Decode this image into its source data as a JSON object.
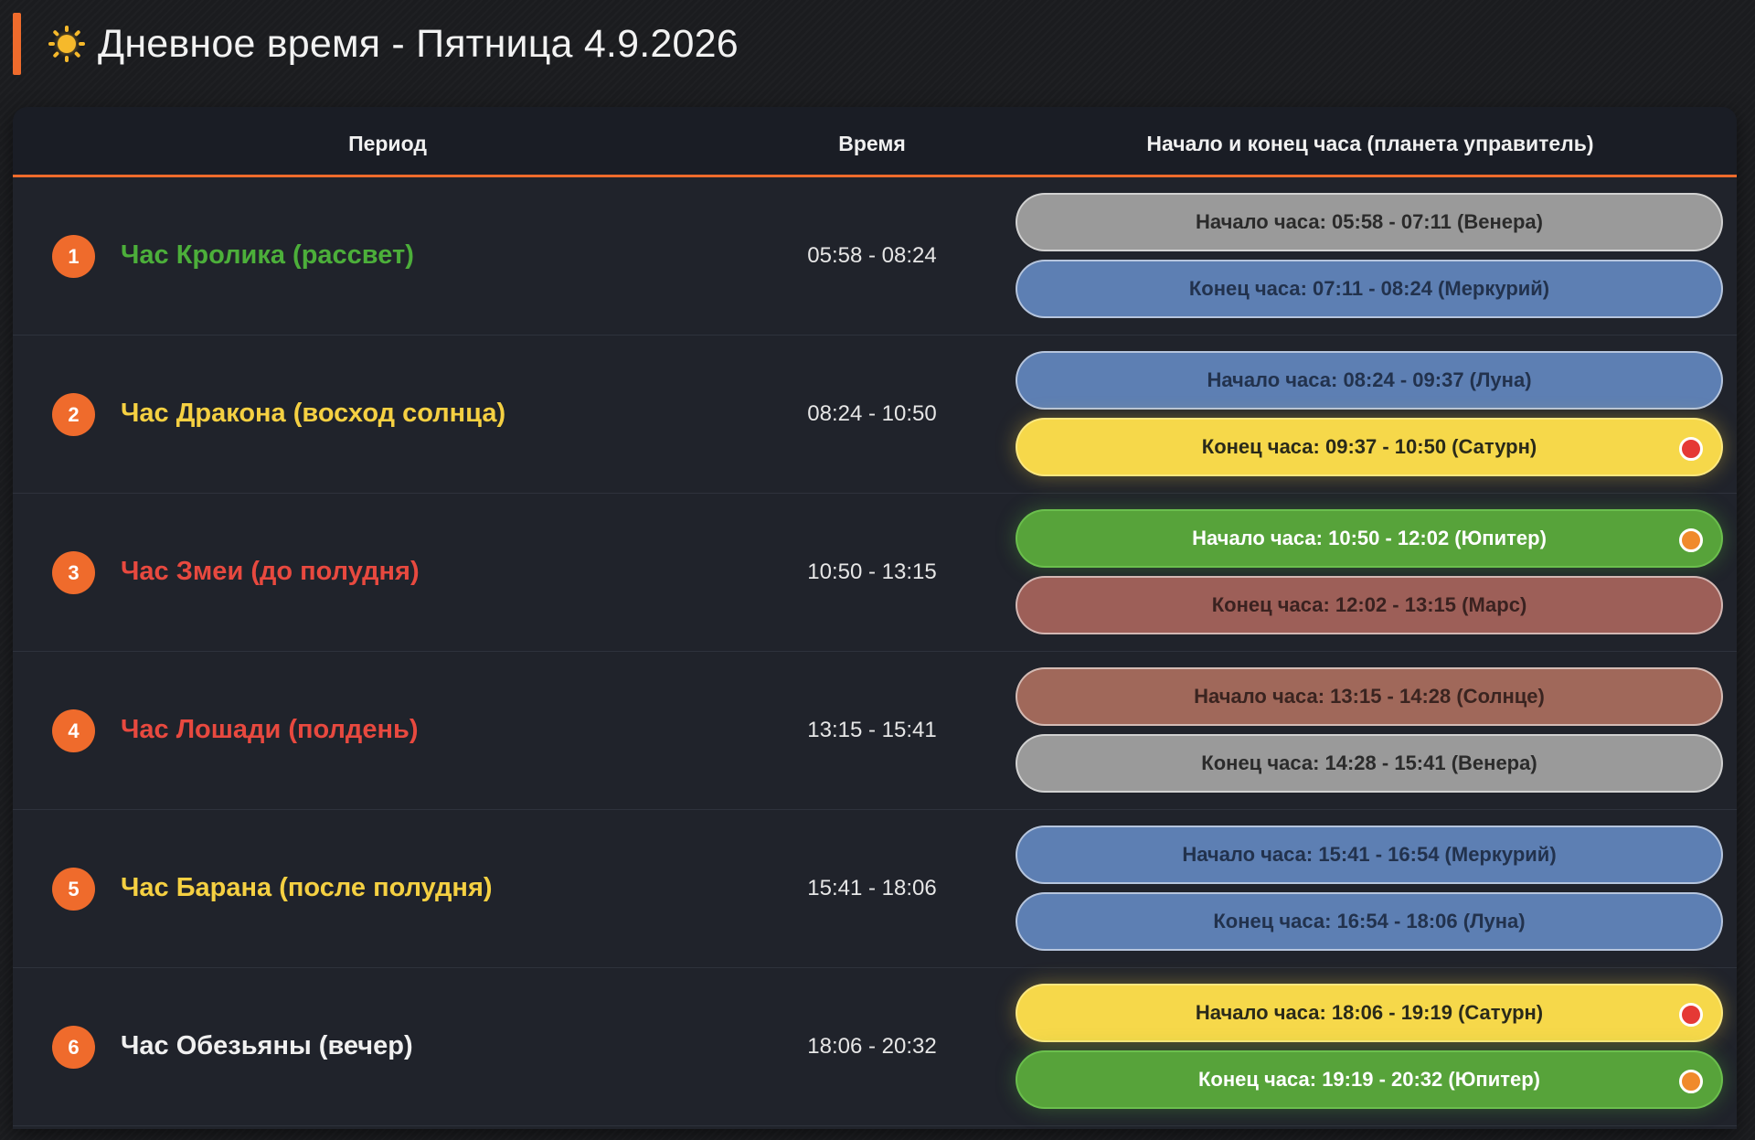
{
  "header": {
    "title": "Дневное время - Пятница 4.9.2026",
    "icon": "sun-icon"
  },
  "table": {
    "columns": [
      "Период",
      "Время",
      "Начало и конец часа (планета управитель)"
    ],
    "rows": [
      {
        "num": "1",
        "period": "Час Кролика (рассвет)",
        "period_color": "#4caf3a",
        "time": "05:58 - 08:24",
        "start": {
          "label": "Начало часа: 05:58 - 07:11 (Венера)",
          "bg": "#9a9a9a",
          "fg": "#2b2b2b",
          "dot": null,
          "glow": null
        },
        "end": {
          "label": "Конец часа: 07:11 - 08:24 (Меркурий)",
          "bg": "#5d7fb3",
          "fg": "#22324d",
          "dot": null,
          "glow": null
        }
      },
      {
        "num": "2",
        "period": "Час Дракона (восход солнца)",
        "period_color": "#f5d042",
        "time": "08:24 - 10:50",
        "start": {
          "label": "Начало часа: 08:24 - 09:37 (Луна)",
          "bg": "#5d7fb3",
          "fg": "#22324d",
          "dot": null,
          "glow": null
        },
        "end": {
          "label": "Конец часа: 09:37 - 10:50 (Сатурн)",
          "bg": "#f6d84a",
          "fg": "#2a2a1a",
          "dot": "#e53935",
          "glow": "yellow"
        }
      },
      {
        "num": "3",
        "period": "Час Змеи (до полудня)",
        "period_color": "#e8493f",
        "time": "10:50 - 13:15",
        "start": {
          "label": "Начало часа: 10:50 - 12:02 (Юпитер)",
          "bg": "#57a33a",
          "fg": "#ffffff",
          "dot": "#f08a2c",
          "glow": "green"
        },
        "end": {
          "label": "Конец часа: 12:02 - 13:15 (Марс)",
          "bg": "#9d5f58",
          "fg": "#3a2220",
          "dot": null,
          "glow": null
        }
      },
      {
        "num": "4",
        "period": "Час Лошади (полдень)",
        "period_color": "#e8493f",
        "time": "13:15 - 15:41",
        "start": {
          "label": "Начало часа: 13:15 - 14:28 (Солнце)",
          "bg": "#a0685a",
          "fg": "#3a2420",
          "dot": null,
          "glow": null
        },
        "end": {
          "label": "Конец часа: 14:28 - 15:41 (Венера)",
          "bg": "#9a9a9a",
          "fg": "#2b2b2b",
          "dot": null,
          "glow": null
        }
      },
      {
        "num": "5",
        "period": "Час Барана (после полудня)",
        "period_color": "#f5d042",
        "time": "15:41 - 18:06",
        "start": {
          "label": "Начало часа: 15:41 - 16:54 (Меркурий)",
          "bg": "#5d7fb3",
          "fg": "#22324d",
          "dot": null,
          "glow": null
        },
        "end": {
          "label": "Конец часа: 16:54 - 18:06 (Луна)",
          "bg": "#5d7fb3",
          "fg": "#22324d",
          "dot": null,
          "glow": null
        }
      },
      {
        "num": "6",
        "period": "Час Обезьяны (вечер)",
        "period_color": "#f0f0f0",
        "time": "18:06 - 20:32",
        "start": {
          "label": "Начало часа: 18:06 - 19:19 (Сатурн)",
          "bg": "#f6d84a",
          "fg": "#2a2a1a",
          "dot": "#e53935",
          "glow": "yellow"
        },
        "end": {
          "label": "Конец часа: 19:19 - 20:32 (Юпитер)",
          "bg": "#57a33a",
          "fg": "#ffffff",
          "dot": "#f08a2c",
          "glow": "green"
        }
      }
    ]
  }
}
